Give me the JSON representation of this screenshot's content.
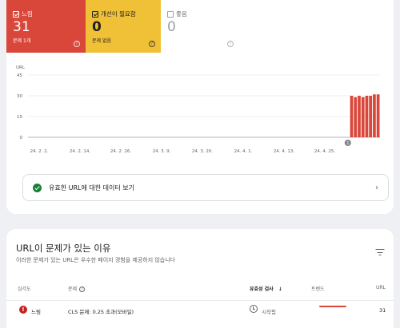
{
  "summary": {
    "poor": {
      "label": "느림",
      "count": "31",
      "sub": "문제 1개",
      "color": "#d9473a",
      "checked": true
    },
    "needs_improvement": {
      "label": "개선이 필요함",
      "count": "0",
      "sub": "문제 없음",
      "color": "#f0c036",
      "checked": true
    },
    "good": {
      "label": "좋음",
      "count": "0",
      "checked": false
    },
    "help_glyph": "?"
  },
  "chart_data": {
    "type": "bar",
    "ylabel": "URL",
    "ylim": [
      0,
      45
    ],
    "yticks": [
      0,
      15,
      30,
      45
    ],
    "grid": true,
    "x_ticks": [
      "24. 2. 2.",
      "24. 2. 14.",
      "24. 2. 26.",
      "24. 3. 9.",
      "24. 3. 20.",
      "24. 4. 1.",
      "24. 4. 13.",
      "24. 4. 25."
    ],
    "series": [
      {
        "color": "#d9473a",
        "values": [
          0,
          0,
          0,
          0,
          0,
          0,
          0,
          0,
          0,
          0,
          0,
          0,
          0,
          0,
          0,
          0,
          0,
          0,
          0,
          0,
          0,
          0,
          0,
          0,
          0,
          0,
          0,
          0,
          0,
          0,
          0,
          0,
          0,
          0,
          0,
          0,
          0,
          0,
          0,
          0,
          0,
          0,
          0,
          0,
          0,
          0,
          0,
          0,
          0,
          0,
          0,
          0,
          0,
          0,
          0,
          0,
          0,
          0,
          0,
          0,
          0,
          0,
          0,
          0,
          0,
          0,
          0,
          0,
          0,
          0,
          0,
          0,
          0,
          0,
          0,
          0,
          0,
          0,
          0,
          0,
          0,
          0,
          0,
          0,
          0,
          30,
          29,
          30,
          29,
          30,
          30,
          31,
          31
        ]
      }
    ],
    "annotation": {
      "label": "1",
      "index": 84
    }
  },
  "valid_urls_link": {
    "label": "유효한 URL에 대한 데이터 보기",
    "chevron": "›"
  },
  "issues": {
    "title": "URL이 문제가 있는 이유",
    "subtitle": "이러한 문제가 있는 URL은 우수한 페이지 경험을 제공하지 않습니다",
    "columns": {
      "severity": "심각도",
      "issue": "문제",
      "validation": "유효성 검사",
      "sort_arrow": "↓",
      "trend": "트렌드",
      "urls": "URL"
    },
    "rows": [
      {
        "severity": "느림",
        "issue": "CLS 문제: 0.25 초과(모바일)",
        "validation": "시작됨",
        "urls": "31",
        "severity_glyph": "!",
        "trend_color": "#d9473a"
      }
    ]
  }
}
